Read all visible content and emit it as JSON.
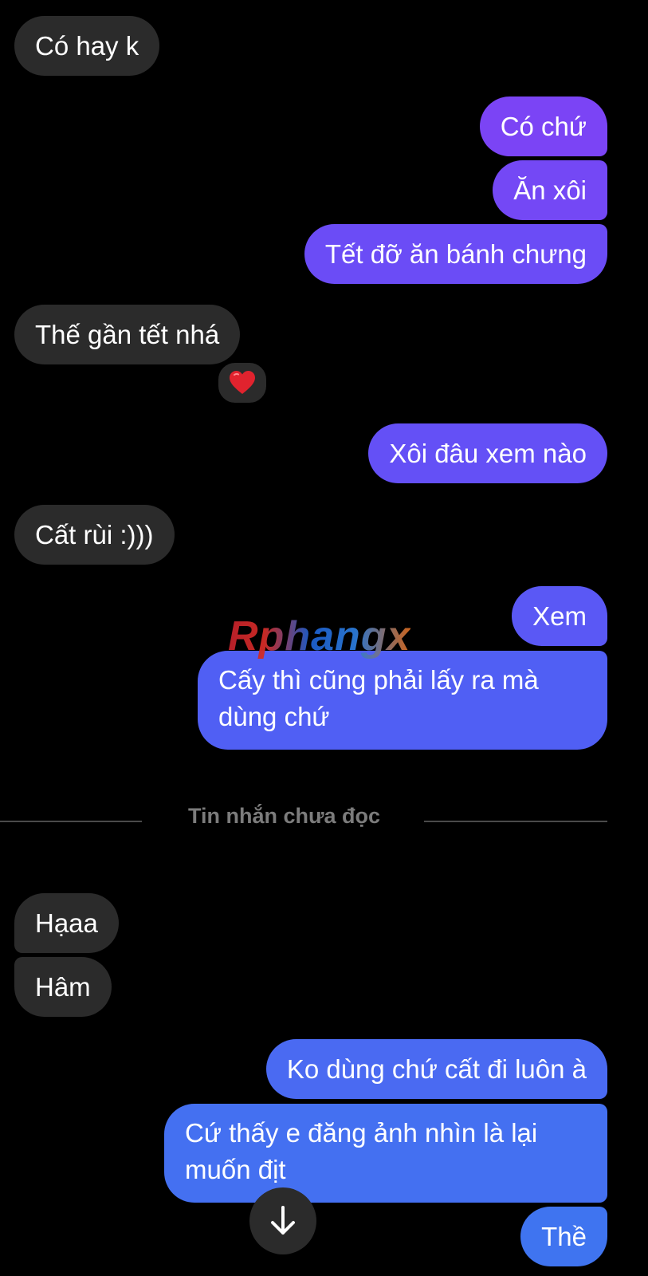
{
  "colors": {
    "background": "#000000",
    "incoming_bubble": "#2b2b2b",
    "outgoing_gradient": [
      "#7b45f5",
      "#6a4cf6",
      "#5161f4",
      "#3f74f0"
    ],
    "divider": "#4a4a4a",
    "divider_text": "#7c7c7c"
  },
  "messages": [
    {
      "id": "m1",
      "direction": "in",
      "text": "Có hay k"
    },
    {
      "id": "m2",
      "direction": "out",
      "text": "Có chứ"
    },
    {
      "id": "m3",
      "direction": "out",
      "text": "Ăn xôi"
    },
    {
      "id": "m4",
      "direction": "out",
      "text": "Tết đỡ ăn bánh chưng"
    },
    {
      "id": "m5",
      "direction": "in",
      "text": "Thế gần tết nhá",
      "reaction": "❤️"
    },
    {
      "id": "m6",
      "direction": "out",
      "text": "Xôi đâu xem nào"
    },
    {
      "id": "m7",
      "direction": "in",
      "text": "Cất rùi :)))"
    },
    {
      "id": "m8",
      "direction": "out",
      "text": "Xem"
    },
    {
      "id": "m9",
      "direction": "out",
      "text": "Cấy thì cũng phải lấy ra mà dùng chứ"
    },
    {
      "id": "m10",
      "direction": "in",
      "text": "Hạaa"
    },
    {
      "id": "m11",
      "direction": "in",
      "text": "Hâm"
    },
    {
      "id": "m12",
      "direction": "out",
      "text": "Ko dùng chứ cất đi luôn à"
    },
    {
      "id": "m13",
      "direction": "out",
      "text": "Cứ thấy e đăng ảnh nhìn là lại muốn địt"
    },
    {
      "id": "m14",
      "direction": "out",
      "text": "Thề"
    }
  ],
  "unread_divider": {
    "label": "Tin nhắn chưa đọc"
  },
  "watermark": {
    "text": "Rphangx"
  },
  "scroll_button": {
    "icon": "arrow-down-icon"
  }
}
